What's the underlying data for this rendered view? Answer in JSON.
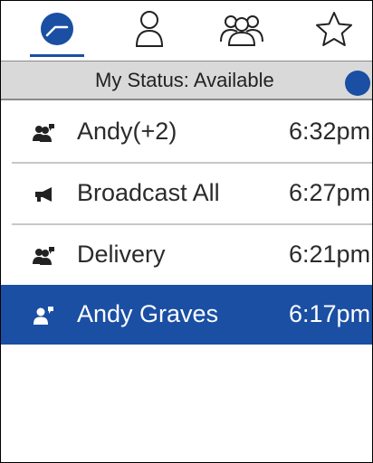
{
  "tabs": [
    {
      "name": "recent",
      "icon": "clock-icon",
      "active": true
    },
    {
      "name": "contacts",
      "icon": "person-icon",
      "active": false
    },
    {
      "name": "groups",
      "icon": "group-icon",
      "active": false
    },
    {
      "name": "favorites",
      "icon": "star-icon",
      "active": false
    }
  ],
  "status": {
    "label": "My Status: Available",
    "indicator_color": "#1a4fa3"
  },
  "conversations": [
    {
      "name": "Andy(+2)",
      "time": "6:32pm",
      "icon": "group-chat-icon",
      "selected": false
    },
    {
      "name": "Broadcast All",
      "time": "6:27pm",
      "icon": "megaphone-icon",
      "selected": false
    },
    {
      "name": "Delivery",
      "time": "6:21pm",
      "icon": "group-chat-icon",
      "selected": false
    },
    {
      "name": "Andy Graves",
      "time": "6:17pm",
      "icon": "person-chat-icon",
      "selected": true
    }
  ],
  "colors": {
    "accent": "#1a4fa3",
    "status_bar_bg": "#d9d9d9",
    "separator": "#c8c8c8"
  }
}
